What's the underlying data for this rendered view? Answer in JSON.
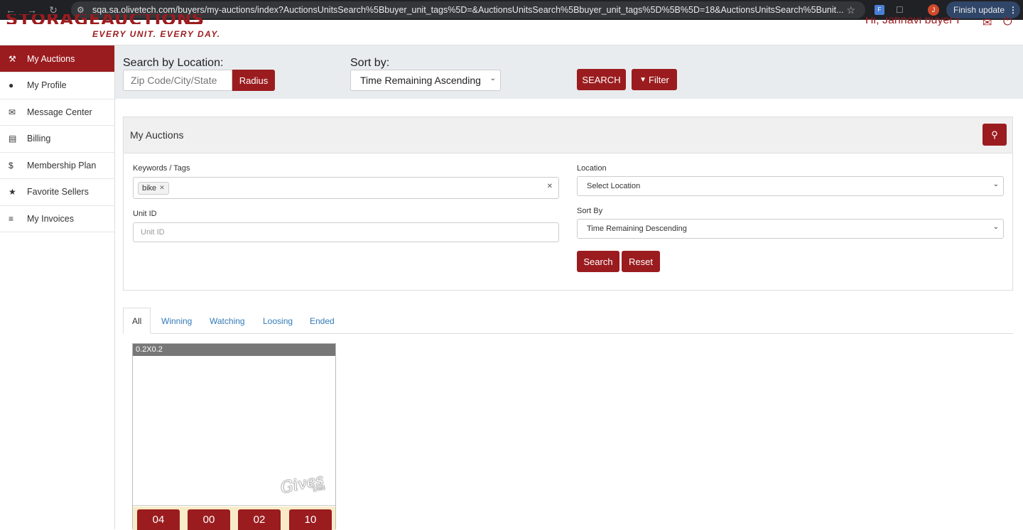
{
  "browser": {
    "url": "sqa.sa.olivetech.com/buyers/my-auctions/index?AuctionsUnitsSearch%5Bbuyer_unit_tags%5D=&AuctionsUnitsSearch%5Bbuyer_unit_tags%5D%5B%5D=18&AuctionsUnitsSearch%5Bunit...",
    "avatar_letter": "J",
    "update_label": "Finish update"
  },
  "header": {
    "logo_text": "STORAGEAUCTIONS",
    "tagline": "EVERY UNIT. EVERY DAY.",
    "greeting": "Hi, Jahnavi buyer I"
  },
  "sidebar": {
    "items": [
      {
        "label": "My Auctions",
        "icon": "gavel-icon"
      },
      {
        "label": "My Profile",
        "icon": "user-icon"
      },
      {
        "label": "Message Center",
        "icon": "envelope-icon"
      },
      {
        "label": "Billing",
        "icon": "credit-card-icon"
      },
      {
        "label": "Membership Plan",
        "icon": "dollar-icon"
      },
      {
        "label": "Favorite Sellers",
        "icon": "star-icon"
      },
      {
        "label": "My Invoices",
        "icon": "list-icon"
      }
    ]
  },
  "search_band": {
    "location_label": "Search by Location:",
    "location_placeholder": "Zip Code/City/State",
    "radius_label": "Radius",
    "sort_label": "Sort by:",
    "sort_value": "Time Remaining Ascending",
    "search_label": "SEARCH",
    "filter_label": "Filter"
  },
  "panel": {
    "title": "My Auctions",
    "keywords_label": "Keywords / Tags",
    "tag": "bike",
    "unit_id_label": "Unit ID",
    "unit_id_placeholder": "Unit ID",
    "location_label": "Location",
    "location_value": "Select Location",
    "sort_label": "Sort By",
    "sort_value": "Time Remaining Descending",
    "search_label": "Search",
    "reset_label": "Reset"
  },
  "tabs": [
    "All",
    "Winning",
    "Watching",
    "Loosing",
    "Ended"
  ],
  "card": {
    "title": "0.2X0.2",
    "watermark": "Gives",
    "watermark_sub": "Unit",
    "timer": [
      "04",
      "00",
      "02",
      "10"
    ]
  },
  "colors": {
    "brand": "#9b1c1f",
    "band_bg": "#e9ecef",
    "link": "#337ab7"
  }
}
